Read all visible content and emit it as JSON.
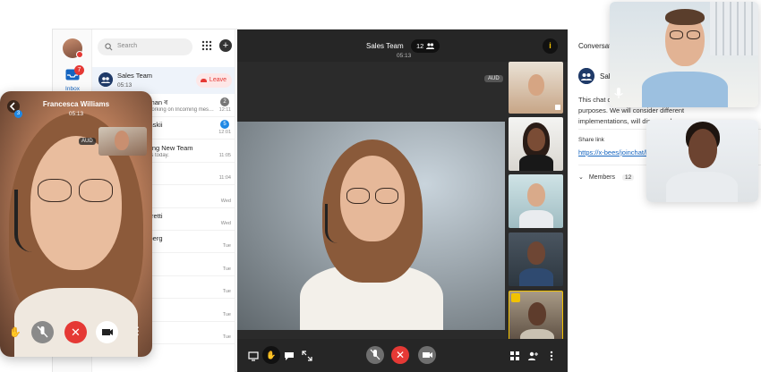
{
  "nav": {
    "inbox_label": "Inbox",
    "inbox_badge": "7"
  },
  "search": {
    "placeholder": "Search"
  },
  "active_call": {
    "title": "Sales Team",
    "time": "05:13",
    "leave_label": "Leave"
  },
  "conversations": [
    {
      "name": "…man ৰ",
      "preview": "…working on Incoming mes…",
      "time": "12:11",
      "badge": "2",
      "badge_color": "#777777"
    },
    {
      "name": "…nskii",
      "preview": "",
      "time": "12:01",
      "badge": "5",
      "badge_color": "#1e88e5"
    },
    {
      "name": "…ling New Team",
      "preview": "…gs today.",
      "time": "11:05",
      "badge": "",
      "badge_color": ""
    },
    {
      "name": "",
      "preview": "",
      "time": "11:04",
      "badge": "",
      "badge_color": ""
    },
    {
      "name": "",
      "preview": "",
      "time": "Wed",
      "badge": "",
      "badge_color": ""
    },
    {
      "name": "…rretti",
      "preview": "",
      "time": "Wed",
      "badge": "",
      "badge_color": ""
    },
    {
      "name": "…berg",
      "preview": "",
      "time": "Tue",
      "badge": "",
      "badge_color": ""
    },
    {
      "name": "",
      "preview": "",
      "time": "Tue",
      "badge": "",
      "badge_color": ""
    },
    {
      "name": "",
      "preview": "",
      "time": "Tue",
      "badge": "",
      "badge_color": ""
    },
    {
      "name": "",
      "preview": "",
      "time": "Tue",
      "badge": "",
      "badge_color": ""
    },
    {
      "name": "",
      "preview": "",
      "time": "Tue",
      "badge": "",
      "badge_color": ""
    }
  ],
  "video": {
    "title": "Sales Team",
    "time": "05:13",
    "participants": "12",
    "info": "i",
    "aud": "AUD"
  },
  "panel": {
    "title": "Conversatio…",
    "team_name": "Sal…",
    "desc_line1": "This chat c…",
    "desc_line2": "purposes. We will consider different",
    "desc_line3": "implementations, will discuss abo…",
    "more": "more",
    "share_label": "Share link",
    "share_link": "https://x-bees/joinchat/hF…",
    "members_label": "Members",
    "members_count": "12"
  },
  "phone": {
    "name": "Francesca Williams",
    "time": "05:13",
    "aud": "AUD",
    "back_badge": "3"
  },
  "colors": {
    "accent": "#1565c0",
    "danger": "#e53935",
    "highlight": "#f2c200",
    "dark": "#2b2b2b"
  }
}
